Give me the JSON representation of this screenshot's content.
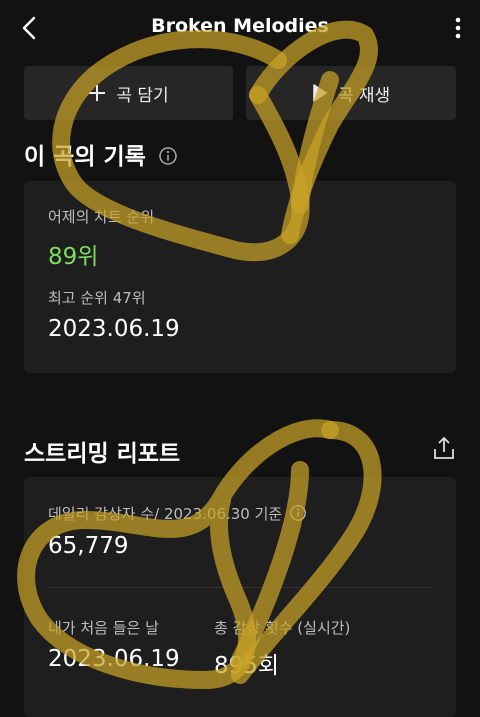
{
  "header": {
    "title": "Broken Melodies"
  },
  "actions": {
    "add_label": "곡 담기",
    "play_label": "곡 재생"
  },
  "record": {
    "title": "이 곡의 기록",
    "yesterday_label": "어제의 차트 순위",
    "yesterday_value": "89위",
    "best_label": "최고 순위 47위",
    "best_date": "2023.06.19"
  },
  "streaming": {
    "title": "스트리밍 리포트",
    "daily_label": "데일리 감상자 수/ 2023.06.30 기준",
    "daily_value": "65,779",
    "first_listen_label": "내가 처음 들은 날",
    "first_listen_value": "2023.06.19",
    "total_label": "총 감상 횟수 (실시간)",
    "total_value": "895회"
  },
  "colors": {
    "accent_green": "#7ddc5c",
    "heart_overlay": "#c9a227"
  },
  "icons": [
    "back-arrow-icon",
    "more-vert-icon",
    "plus-icon",
    "play-icon",
    "info-icon",
    "share-upload-icon",
    "heart-overlay"
  ]
}
